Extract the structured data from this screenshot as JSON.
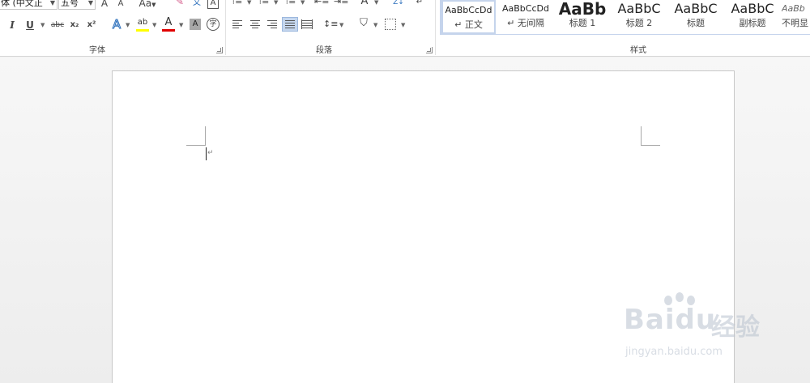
{
  "font_group": {
    "label": "字体",
    "font_name_value": "体 (中文正",
    "font_size_value": "五号",
    "grow_font_icon": "font-grow-icon",
    "shrink_font_icon": "font-shrink-icon",
    "change_case_label": "Aa",
    "italic_label": "I",
    "underline_label": "U",
    "strikethrough_label": "abc",
    "subscript_label": "x₂",
    "superscript_label": "x²",
    "text_effects_label": "A",
    "highlight_label": "ab",
    "font_color_label": "A",
    "char_shading_label": "A",
    "enclose_char_label": "字",
    "char_border_label": "A",
    "phonetic_label": "文",
    "highlight_color": "#ffff00",
    "font_color_color": "#e00000"
  },
  "paragraph_group": {
    "label": "段落",
    "sort_label": "Z↓"
  },
  "styles_group": {
    "label": "样式",
    "items": [
      {
        "sample": "AaBbCcDd",
        "name": "↵ 正文"
      },
      {
        "sample": "AaBbCcDd",
        "name": "↵ 无间隔"
      },
      {
        "sample": "AaBb",
        "name": "标题 1"
      },
      {
        "sample": "AaBbC",
        "name": "标题 2"
      },
      {
        "sample": "AaBbC",
        "name": "标题"
      },
      {
        "sample": "AaBbC",
        "name": "副标题"
      },
      {
        "sample": "AaBb",
        "name": "不明显"
      }
    ]
  },
  "document": {
    "paragraph_mark": "↵"
  },
  "watermark": {
    "logo_text": "Baidu",
    "logo_suffix": "经验",
    "url": "jingyan.baidu.com"
  }
}
